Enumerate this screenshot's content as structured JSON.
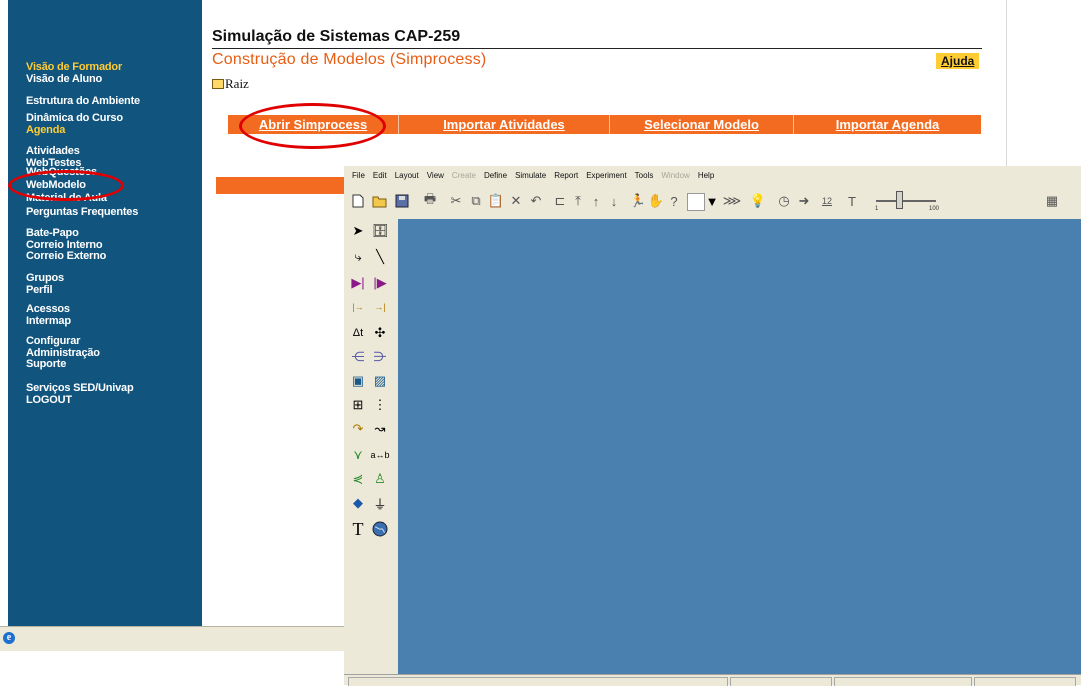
{
  "sidebar": {
    "items": [
      {
        "label": "Visão de Formador",
        "yellow": true
      },
      {
        "label": "Visão de Aluno"
      },
      {
        "label": "Estrutura do Ambiente"
      },
      {
        "label": "Dinâmica do Curso"
      },
      {
        "label": "Agenda",
        "yellow": true
      },
      {
        "label": "Atividades"
      },
      {
        "label": "WebTestes"
      },
      {
        "label": "WebQuestões"
      },
      {
        "label": "WebModelo"
      },
      {
        "label": "Material de Aula"
      },
      {
        "label": "Perguntas Frequentes"
      },
      {
        "label": "Bate-Papo"
      },
      {
        "label": "Correio Interno"
      },
      {
        "label": "Correio Externo"
      },
      {
        "label": "Grupos"
      },
      {
        "label": "Perfil"
      },
      {
        "label": "Acessos"
      },
      {
        "label": "Intermap"
      },
      {
        "label": "Configurar"
      },
      {
        "label": "Administração"
      },
      {
        "label": "Suporte"
      },
      {
        "label": "Serviços SED/Univap"
      },
      {
        "label": "LOGOUT"
      }
    ]
  },
  "header": {
    "title": "Simulação de Sistemas CAP-259",
    "subtitle": "Construção de Modelos (Simprocess)",
    "help_label": "Ajuda",
    "root_label": "Raiz"
  },
  "tabs": [
    {
      "label": "Abrir Simprocess"
    },
    {
      "label": "Importar Atividades"
    },
    {
      "label": "Selecionar Modelo"
    },
    {
      "label": "Importar Agenda"
    }
  ],
  "simprocess": {
    "menu": [
      {
        "label": "File"
      },
      {
        "label": "Edit"
      },
      {
        "label": "Layout"
      },
      {
        "label": "View"
      },
      {
        "label": "Create",
        "disabled": true
      },
      {
        "label": "Define"
      },
      {
        "label": "Simulate"
      },
      {
        "label": "Report"
      },
      {
        "label": "Experiment"
      },
      {
        "label": "Tools"
      },
      {
        "label": "Window",
        "disabled": true
      },
      {
        "label": "Help"
      }
    ],
    "slider_min": "1",
    "slider_max": "100",
    "text_size": "12",
    "canvas_color": "#4a80b0"
  },
  "colors": {
    "sidebar_bg": "#11557f",
    "sidebar_highlight": "#ffcc33",
    "accent_orange": "#f26b21",
    "subtitle_orange": "#e85d12",
    "annotation_red": "#e00000"
  }
}
